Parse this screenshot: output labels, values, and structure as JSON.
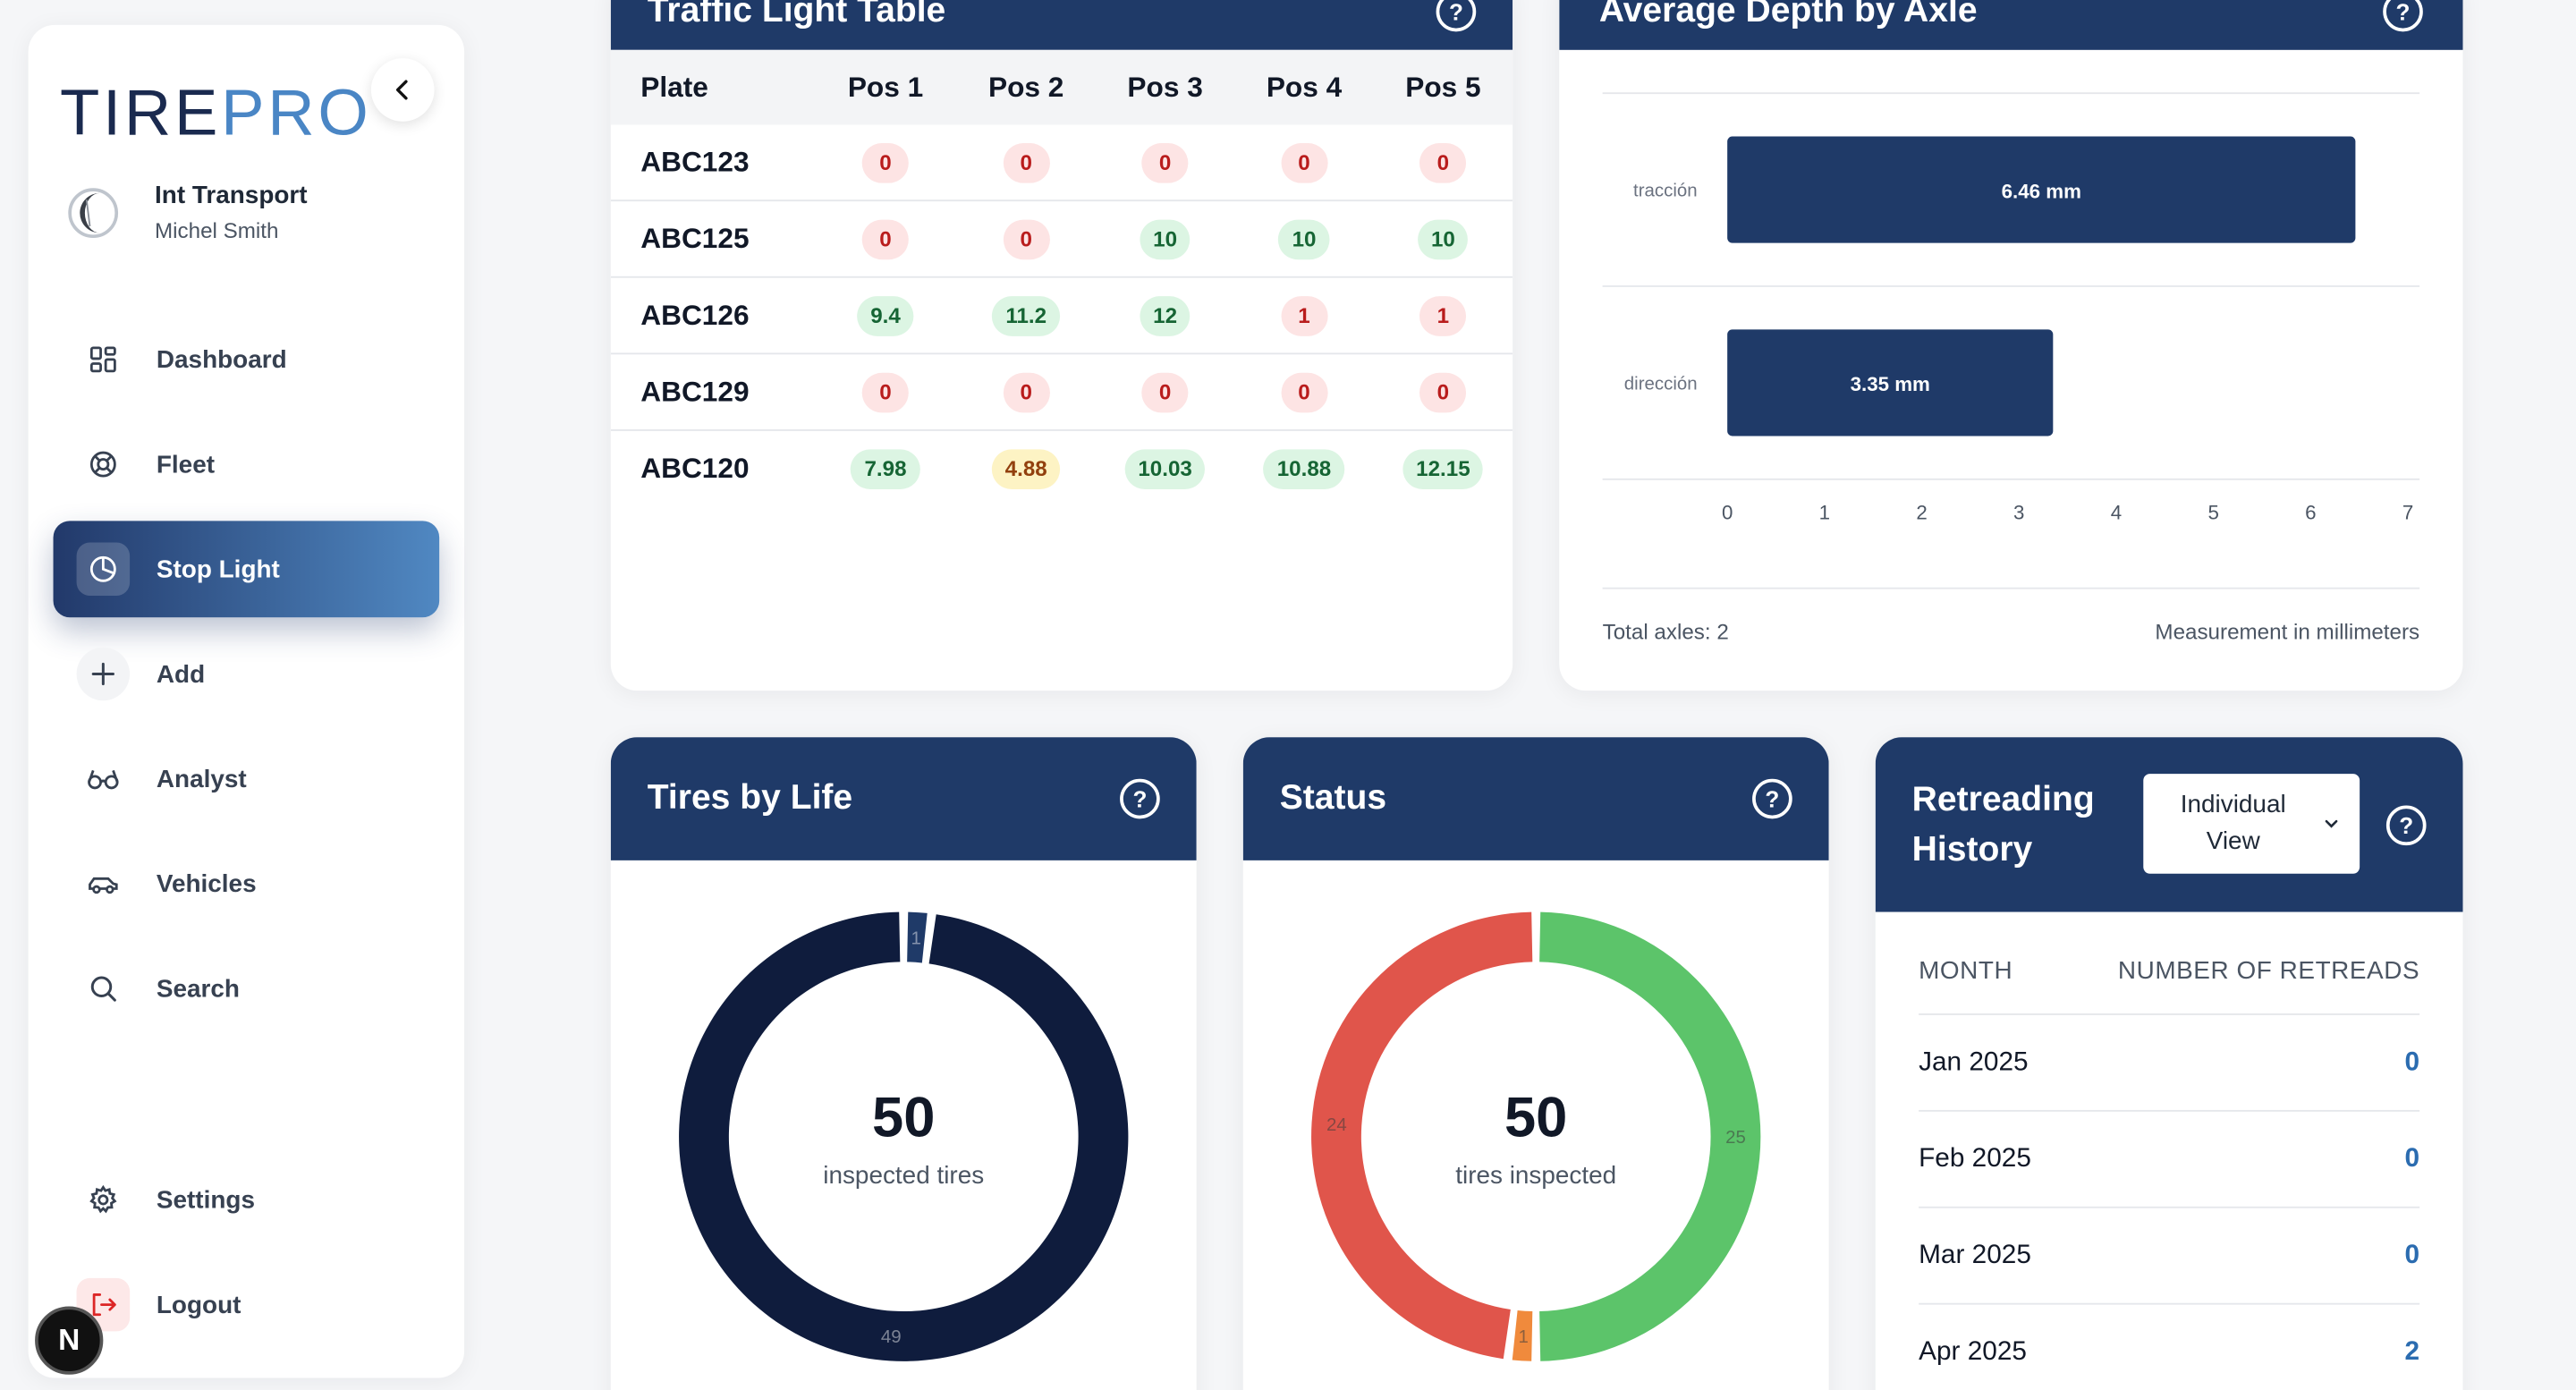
{
  "sidebar": {
    "logo_main": "TIRE",
    "logo_accent": "PRO",
    "company_name": "Int Transport",
    "user_name": "Michel Smith",
    "items": [
      {
        "label": "Dashboard",
        "icon": "grid-icon"
      },
      {
        "label": "Fleet",
        "icon": "lifebuoy-icon"
      },
      {
        "label": "Stop Light",
        "icon": "pie-icon",
        "active": true
      },
      {
        "label": "Add",
        "icon": "plus-icon"
      },
      {
        "label": "Analyst",
        "icon": "glasses-icon"
      },
      {
        "label": "Vehicles",
        "icon": "car-icon"
      },
      {
        "label": "Search",
        "icon": "search-icon"
      },
      {
        "label": "Settings",
        "icon": "gear-icon"
      },
      {
        "label": "Logout",
        "icon": "logout-icon"
      }
    ],
    "badge": "N"
  },
  "traffic_table": {
    "title": "Traffic Light Table",
    "headers": [
      "Plate",
      "Pos 1",
      "Pos 2",
      "Pos 3",
      "Pos 4",
      "Pos 5"
    ],
    "rows": [
      {
        "plate": "ABC123",
        "values": [
          "0",
          "0",
          "0",
          "0",
          "0"
        ],
        "status": [
          "red",
          "red",
          "red",
          "red",
          "red"
        ]
      },
      {
        "plate": "ABC125",
        "values": [
          "0",
          "0",
          "10",
          "10",
          "10"
        ],
        "status": [
          "red",
          "red",
          "green",
          "green",
          "green"
        ]
      },
      {
        "plate": "ABC126",
        "values": [
          "9.4",
          "11.2",
          "12",
          "1",
          "1"
        ],
        "status": [
          "green",
          "green",
          "green",
          "red",
          "red"
        ]
      },
      {
        "plate": "ABC129",
        "values": [
          "0",
          "0",
          "0",
          "0",
          "0"
        ],
        "status": [
          "red",
          "red",
          "red",
          "red",
          "red"
        ]
      },
      {
        "plate": "ABC120",
        "values": [
          "7.98",
          "4.88",
          "10.03",
          "10.88",
          "12.15"
        ],
        "status": [
          "green",
          "yellow",
          "green",
          "green",
          "green"
        ]
      }
    ]
  },
  "axis_depth": {
    "title": "Average Depth by Axle",
    "total_label": "Total axles: 2",
    "unit_note": "Measurement in millimeters"
  },
  "tires_by_life": {
    "title": "Tires by Life",
    "center_value": "50",
    "center_label": "inspected tires"
  },
  "status": {
    "title": "Status",
    "center_value": "50",
    "center_label": "tires inspected"
  },
  "retreading": {
    "title_line1": "Retreading",
    "title_line2": "History",
    "view_line1": "Individual",
    "view_line2": "View",
    "col_month": "MONTH",
    "col_count": "NUMBER OF RETREADS",
    "rows": [
      {
        "month": "Jan 2025",
        "count": "0"
      },
      {
        "month": "Feb 2025",
        "count": "0"
      },
      {
        "month": "Mar 2025",
        "count": "0"
      },
      {
        "month": "Apr 2025",
        "count": "2"
      }
    ]
  },
  "chart_data": [
    {
      "type": "bar",
      "orientation": "horizontal",
      "categories": [
        "tracción",
        "dirección"
      ],
      "values": [
        6.46,
        3.35
      ],
      "value_labels": [
        "6.46 mm",
        "3.35 mm"
      ],
      "xlim": [
        0,
        7
      ],
      "xticks": [
        "0",
        "1",
        "2",
        "3",
        "4",
        "5",
        "6",
        "7"
      ],
      "color": "#1f3a68"
    },
    {
      "type": "pie",
      "style": "donut",
      "labels": [
        "1",
        "49"
      ],
      "values": [
        1,
        49
      ],
      "colors": [
        "#1f3a68",
        "#0f1c3d"
      ]
    },
    {
      "type": "pie",
      "style": "donut",
      "labels": [
        "25",
        "1",
        "24"
      ],
      "values": [
        25,
        1,
        24
      ],
      "colors": [
        "#5cc46a",
        "#f08a3c",
        "#e0554b"
      ]
    }
  ]
}
